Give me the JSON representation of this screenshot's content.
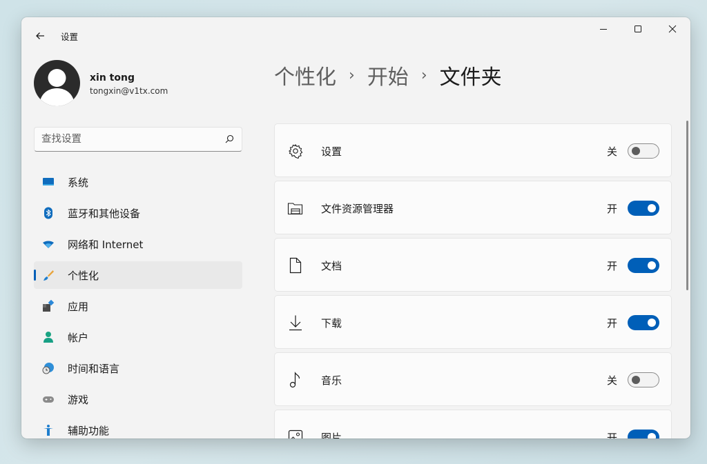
{
  "app": {
    "title": "设置"
  },
  "profile": {
    "name": "xin tong",
    "email": "tongxin@v1tx.com"
  },
  "search": {
    "placeholder": "查找设置"
  },
  "nav": {
    "items": [
      {
        "label": "系统",
        "icon": "system-icon"
      },
      {
        "label": "蓝牙和其他设备",
        "icon": "bluetooth-icon"
      },
      {
        "label": "网络和 Internet",
        "icon": "wifi-icon"
      },
      {
        "label": "个性化",
        "icon": "personalization-brush-icon",
        "active": true
      },
      {
        "label": "应用",
        "icon": "apps-icon"
      },
      {
        "label": "帐户",
        "icon": "account-icon"
      },
      {
        "label": "时间和语言",
        "icon": "time-language-icon"
      },
      {
        "label": "游戏",
        "icon": "gaming-icon"
      },
      {
        "label": "辅助功能",
        "icon": "accessibility-icon"
      }
    ]
  },
  "breadcrumb": [
    "个性化",
    "开始",
    "文件夹"
  ],
  "folders": [
    {
      "label": "设置",
      "icon": "gear-icon",
      "state": "关",
      "on": false
    },
    {
      "label": "文件资源管理器",
      "icon": "file-explorer-icon",
      "state": "开",
      "on": true
    },
    {
      "label": "文档",
      "icon": "document-icon",
      "state": "开",
      "on": true
    },
    {
      "label": "下载",
      "icon": "download-icon",
      "state": "开",
      "on": true
    },
    {
      "label": "音乐",
      "icon": "music-icon",
      "state": "关",
      "on": false
    },
    {
      "label": "图片",
      "icon": "pictures-icon",
      "state": "开",
      "on": true
    }
  ],
  "colors": {
    "accent": "#005fb8",
    "background": "#f3f3f3",
    "card": "#fbfbfb"
  }
}
